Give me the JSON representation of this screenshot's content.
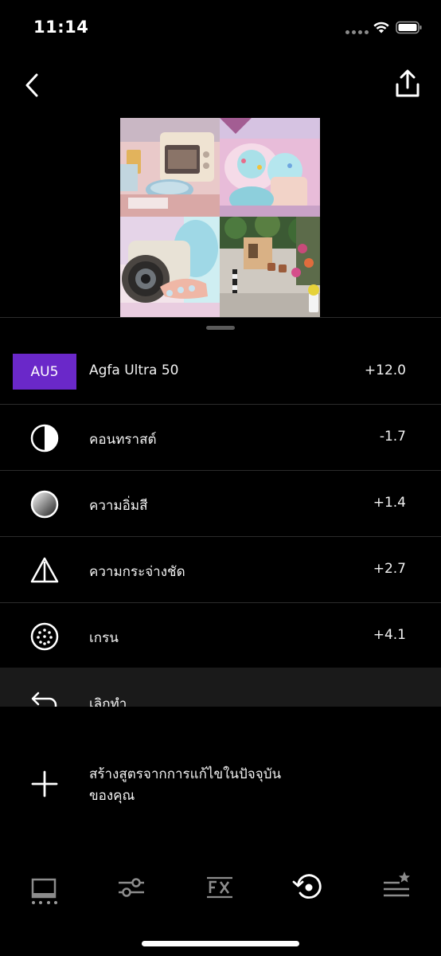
{
  "status_bar": {
    "time": "11:14"
  },
  "preset": {
    "code": "AU5",
    "name": "Agfa Ultra 50",
    "value": "+12.0",
    "badge_color": "#6a28c9"
  },
  "adjustments": [
    {
      "icon": "contrast-icon",
      "label": "คอนทราสต์",
      "value": "-1.7"
    },
    {
      "icon": "saturation-icon",
      "label": "ความอิ่มสี",
      "value": "+1.4"
    },
    {
      "icon": "sharpen-icon",
      "label": "ความกระจ่างชัด",
      "value": "+2.7"
    },
    {
      "icon": "grain-icon",
      "label": "เกรน",
      "value": "+4.1"
    }
  ],
  "undo": {
    "label": "เลิกทำ"
  },
  "recipe": {
    "label": "สร้างสูตรจากการแก้ไขในปัจจุบันของคุณ"
  },
  "toolbar": {
    "items": [
      "presets-icon",
      "tools-icon",
      "fx-icon",
      "history-icon",
      "recipes-icon"
    ]
  }
}
